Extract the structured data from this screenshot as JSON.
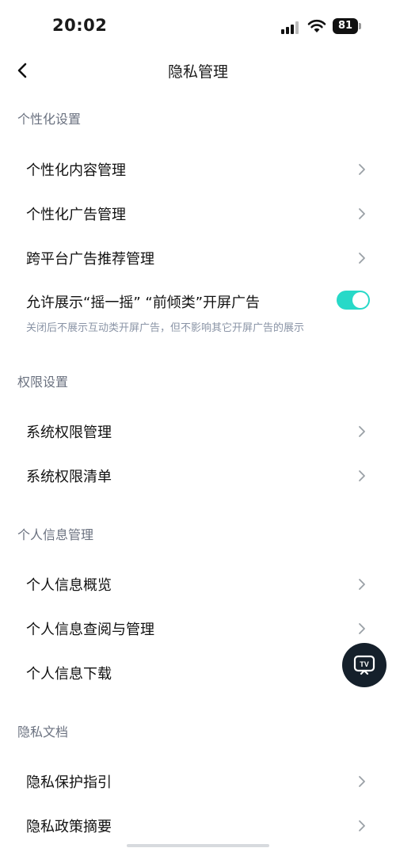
{
  "status_bar": {
    "time": "20:02",
    "battery": "81"
  },
  "nav": {
    "title": "隐私管理"
  },
  "sections": [
    {
      "title": "个性化设置",
      "items": [
        {
          "label": "个性化内容管理"
        },
        {
          "label": "个性化广告管理"
        },
        {
          "label": "跨平台广告推荐管理"
        }
      ],
      "toggle_item": {
        "label": "允许展示“摇一摇” “前倾类”开屏广告",
        "description": "关闭后不展示互动类开屏广告，但不影响其它开屏广告的展示",
        "enabled": true
      }
    },
    {
      "title": "权限设置",
      "items": [
        {
          "label": "系统权限管理"
        },
        {
          "label": "系统权限清单"
        }
      ]
    },
    {
      "title": "个人信息管理",
      "items": [
        {
          "label": "个人信息概览"
        },
        {
          "label": "个人信息查阅与管理"
        },
        {
          "label": "个人信息下载"
        }
      ]
    },
    {
      "title": "隐私文档",
      "items": [
        {
          "label": "隐私保护指引"
        },
        {
          "label": "隐私政策摘要"
        }
      ]
    }
  ],
  "float_button": {
    "icon": "tv-icon",
    "text": "TV"
  },
  "colors": {
    "accent": "#27d9c8",
    "section_title": "#6b7280",
    "description": "#8a94a6"
  }
}
